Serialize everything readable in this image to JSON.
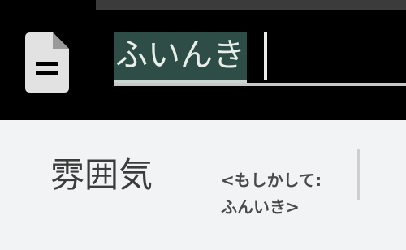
{
  "input": {
    "composing_text": "ふいんき",
    "icon": "document-icon"
  },
  "candidates": {
    "main": "雰囲気",
    "suggestion_line1": "<もしかして:",
    "suggestion_line2": "ふんいき>"
  }
}
